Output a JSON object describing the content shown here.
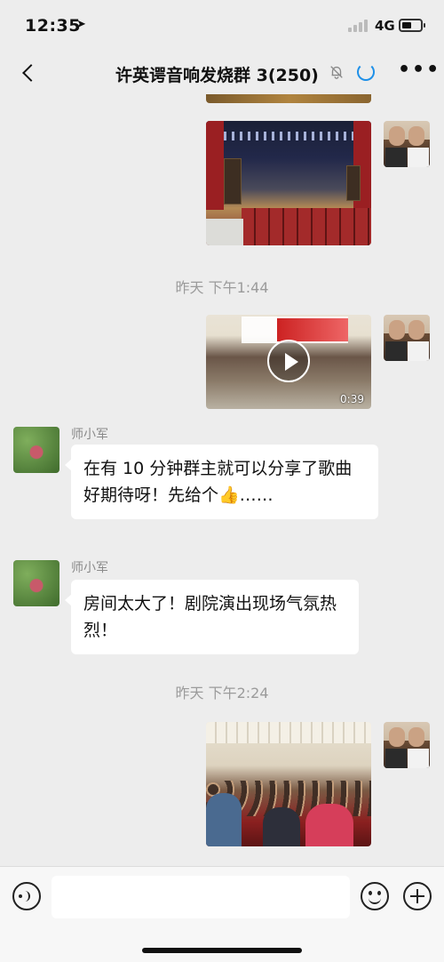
{
  "status_bar": {
    "time": "12:35",
    "location_arrow": "➤",
    "network": "4G"
  },
  "header": {
    "title": "许英谔音响发烧群 3(250)",
    "mute_icon": "bell-off-icon",
    "more": "•••"
  },
  "messages": [
    {
      "type": "image",
      "from": "me",
      "description": "stage-photo"
    },
    {
      "type": "timestamp",
      "text": "昨天 下午1:44"
    },
    {
      "type": "video",
      "from": "me",
      "duration": "0:39"
    },
    {
      "type": "text",
      "from": "师小军",
      "sender": "师小军",
      "text": "在有 10 分钟群主就可以分享了歌曲好期待呀！先给个👍……"
    },
    {
      "type": "text",
      "from": "师小军",
      "sender": "师小军",
      "text": "房间太大了！剧院演出现场气氛热烈！"
    },
    {
      "type": "timestamp",
      "text": "昨天 下午2:24"
    },
    {
      "type": "image",
      "from": "me",
      "description": "audience-photo"
    }
  ],
  "input": {
    "placeholder": "",
    "value": ""
  }
}
